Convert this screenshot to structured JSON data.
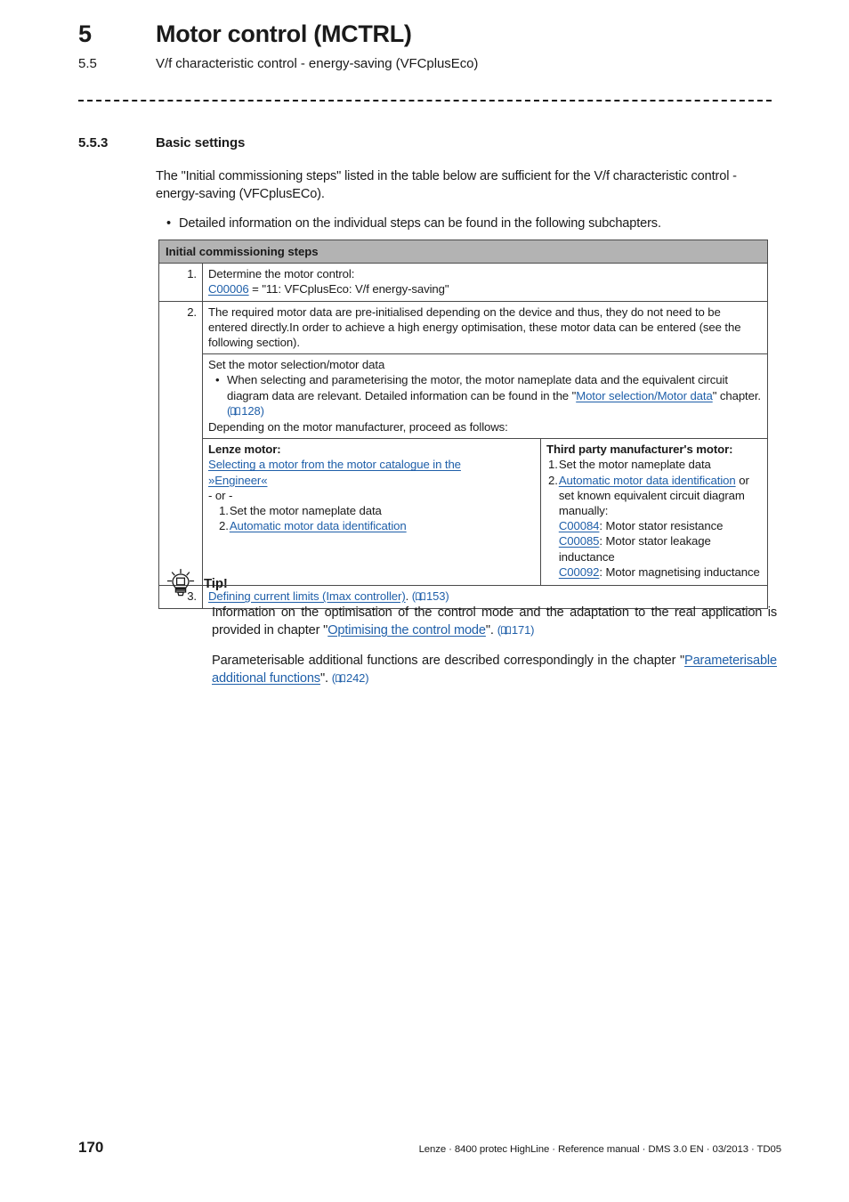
{
  "header": {
    "chapter_number": "5",
    "chapter_title": "Motor control (MCTRL)",
    "section_number": "5.5",
    "section_title": "V/f characteristic control - energy-saving (VFCplusEco)"
  },
  "section": {
    "number": "5.5.3",
    "title": "Basic settings"
  },
  "intro": {
    "paragraph": "The \"Initial commissioning steps\" listed in the table below are sufficient for the V/f characteristic control - energy-saving (VFCplusECo).",
    "bullet_marker": "•",
    "bullet": "Detailed information on the individual steps can be found in the following subchapters."
  },
  "table": {
    "header": "Initial commissioning steps",
    "row1": {
      "number": "1.",
      "line1": "Determine the motor control:",
      "link": "C00006",
      "after_link": " = \"11: VFCplusEco: V/f energy-saving\""
    },
    "row2": {
      "number": "2.",
      "text": "The required motor data are pre-initialised depending on the device and thus, they do not need to be entered directly.In order to achieve a high energy optimisation, these motor data can be entered (see the following section).",
      "sub_a": {
        "title": "Set the motor selection/motor data",
        "bullet_marker": "•",
        "bullet_before_link": "When selecting and parameterising the motor, the motor nameplate data and the equivalent circuit diagram data are relevant. Detailed information can be found in the \"",
        "bullet_link": "Motor selection/Motor data",
        "bullet_after_link": "\" chapter. ",
        "page_ref": "128",
        "closing": "Depending on the motor manufacturer, proceed as follows:"
      },
      "sub_b": {
        "left": {
          "title": "Lenze motor:",
          "link_line1": "Selecting a motor from the motor catalogue in the ",
          "link_line2": "»Engineer«",
          "or": "- or -",
          "item1_num": "1.",
          "item1": "Set the motor nameplate data",
          "item2_num": "2.",
          "item2_link": "Automatic motor data identification"
        },
        "right": {
          "title": "Third party manufacturer's motor:",
          "item1_num": "1.",
          "item1": "Set the motor nameplate data",
          "item2_num": "2.",
          "item2_link": "Automatic motor data identification",
          "item2_after": " or set known equivalent circuit diagram manually:",
          "params": [
            {
              "code": "C00084",
              "desc": ": Motor stator resistance"
            },
            {
              "code": "C00085",
              "desc": ": Motor stator leakage inductance"
            },
            {
              "code": "C00092",
              "desc": ": Motor magnetising inductance"
            }
          ]
        }
      }
    },
    "row3": {
      "number": "3.",
      "link": "Defining current limits (Imax controller)",
      "after_link": ". ",
      "page_ref": "153"
    }
  },
  "tip": {
    "label": "Tip!",
    "icon": "lightbulb-icon",
    "p1_before": "Information on the optimisation of the control mode and the adaptation to the real application is provided in chapter \"",
    "p1_link": "Optimising the control mode",
    "p1_after": "\". ",
    "p1_page": "171",
    "p2_before": "Parameterisable additional functions are described correspondingly in the chapter \"",
    "p2_link": "Parameterisable additional functions",
    "p2_after": "\". ",
    "p2_page": "242"
  },
  "footer": {
    "page_number": "170",
    "text": "Lenze · 8400 protec HighLine · Reference manual · DMS 3.0 EN · 03/2013 · TD05"
  },
  "colors": {
    "link": "#1f5fa9",
    "table_header_bg": "#b3b3b3",
    "table_border": "#4a4a4a",
    "text": "#1a1a1a"
  }
}
